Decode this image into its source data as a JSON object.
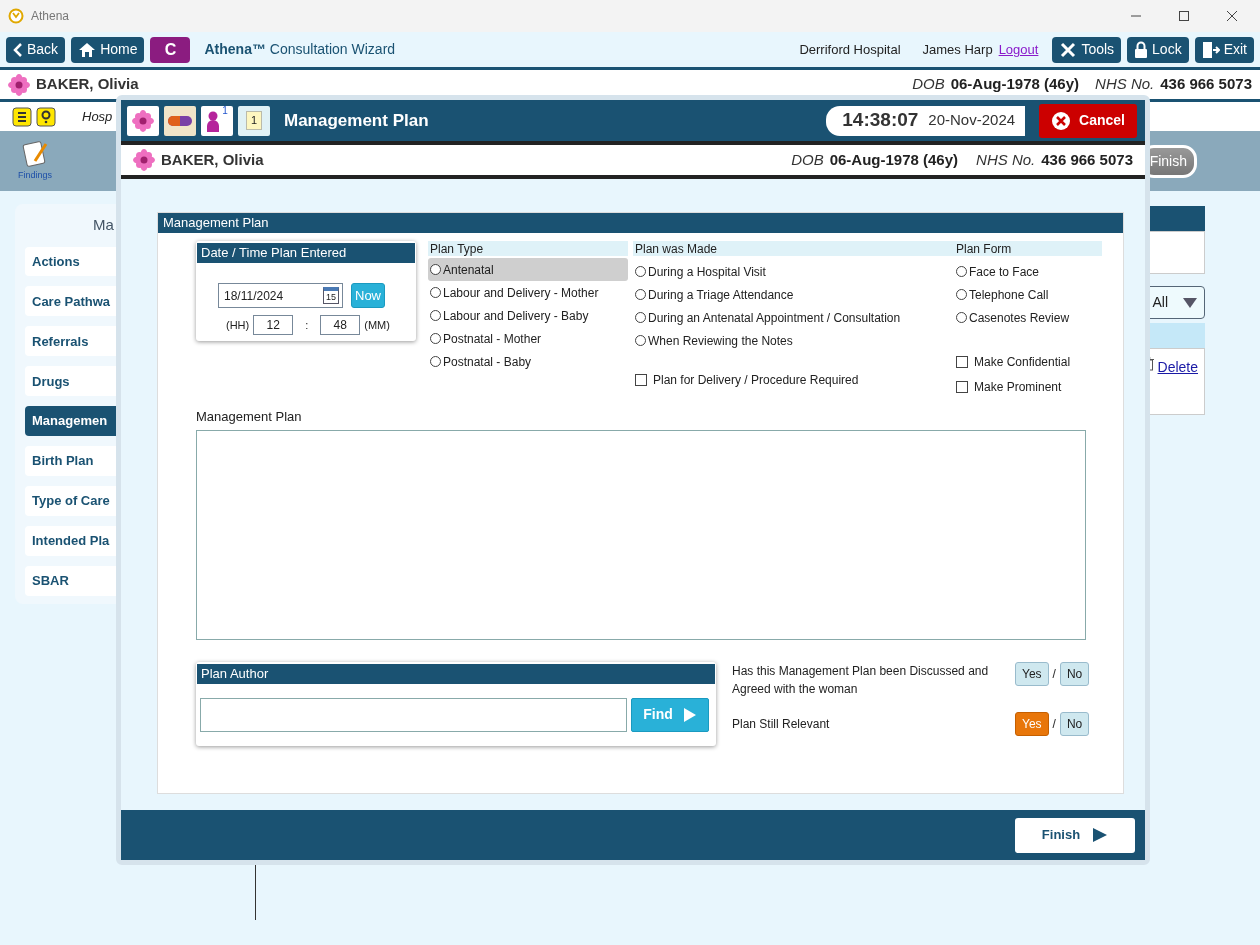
{
  "window": {
    "title": "Athena"
  },
  "toolbar": {
    "nav_buttons": [
      {
        "kind": "back",
        "label": "Back"
      },
      {
        "kind": "home",
        "label": "Home"
      }
    ],
    "badge": "C",
    "app_name": "Athena™",
    "app_subtitle": "Consultation Wizard",
    "hospital": "Derriford Hospital",
    "user": "James Harp",
    "logout": "Logout",
    "tool_buttons": [
      {
        "kind": "tools",
        "label": "Tools"
      },
      {
        "kind": "lock",
        "label": "Lock"
      },
      {
        "kind": "exit",
        "label": "Exit"
      }
    ]
  },
  "patient": {
    "name": "BAKER, Olivia",
    "dob_label": "DOB",
    "dob": "06-Aug-1978 (46y)",
    "nhs_label": "NHS No.",
    "nhs": "436 966 5073"
  },
  "info_bar": {
    "text": "Hosp"
  },
  "wizard_bar": {
    "findings": "Findings",
    "finish": {
      "label": "Finish",
      "disabled": true
    }
  },
  "sidebar": {
    "heading": "Ma",
    "items": [
      {
        "label": "Actions",
        "selected": false
      },
      {
        "label": "Care Pathwa",
        "selected": false
      },
      {
        "label": "Referrals",
        "selected": false
      },
      {
        "label": "Drugs",
        "selected": false
      },
      {
        "label": "Managemen",
        "selected": true
      },
      {
        "label": "Birth Plan",
        "selected": false
      },
      {
        "label": "Type of Care",
        "selected": false
      },
      {
        "label": "Intended Pla",
        "selected": false
      },
      {
        "label": "SBAR",
        "selected": false
      }
    ]
  },
  "right_panel": {
    "filter": "All",
    "link": "Delete"
  },
  "modal": {
    "icon_buttons": [
      {
        "kind": "flower"
      },
      {
        "kind": "pill"
      },
      {
        "kind": "person",
        "text": "1"
      },
      {
        "kind": "calendar",
        "text": "1"
      }
    ],
    "title": "Management Plan",
    "time": "14:38:07",
    "date": "20-Nov-2024",
    "cancel": "Cancel",
    "patient": {
      "name": "BAKER, Olivia",
      "dob_label": "DOB",
      "dob": "06-Aug-1978 (46y)",
      "nhs_label": "NHS No.",
      "nhs": "436 966 5073"
    },
    "section_title": "Management Plan",
    "date_time": {
      "title": "Date / Time Plan Entered",
      "date": "18/11/2024",
      "calendar_day": "15",
      "now": "Now",
      "hh_label": "(HH)",
      "hh": "12",
      "separator": ":",
      "mm": "48",
      "mm_label": "(MM)"
    },
    "plan_type": {
      "heading": "Plan Type",
      "options": [
        {
          "label": "Antenatal",
          "selected": false,
          "focused": true
        },
        {
          "label": "Labour and Delivery - Mother",
          "selected": false,
          "focused": false
        },
        {
          "label": "Labour and Delivery - Baby",
          "selected": false,
          "focused": false
        },
        {
          "label": "Postnatal - Mother",
          "selected": false,
          "focused": false
        },
        {
          "label": "Postnatal - Baby",
          "selected": false,
          "focused": false
        }
      ]
    },
    "plan_made": {
      "heading": "Plan was Made",
      "options": [
        {
          "label": "During a Hospital Visit",
          "selected": false
        },
        {
          "label": "During a Triage Attendance",
          "selected": false
        },
        {
          "label": "During an Antenatal Appointment / Consultation",
          "selected": false
        },
        {
          "label": "When Reviewing the Notes",
          "selected": false
        }
      ],
      "checkbox": {
        "label": "Plan for Delivery / Procedure Required",
        "checked": false
      }
    },
    "plan_form": {
      "heading": "Plan Form",
      "options": [
        {
          "label": "Face to Face",
          "selected": false
        },
        {
          "label": "Telephone Call",
          "selected": false
        },
        {
          "label": "Casenotes Review",
          "selected": false
        }
      ],
      "checkboxes": [
        {
          "label": "Make Confidential",
          "checked": false
        },
        {
          "label": "Make Prominent",
          "checked": false
        }
      ]
    },
    "notes": {
      "label": "Management Plan"
    },
    "author": {
      "title": "Plan Author",
      "find": "Find"
    },
    "questions": [
      {
        "text": "Has this Management Plan been Discussed and Agreed with the woman",
        "yes": "Yes",
        "separator": "/",
        "no": "No",
        "yes_selected": false,
        "no_selected": false
      },
      {
        "text": "Plan Still Relevant",
        "yes": "Yes",
        "separator": "/",
        "no": "No",
        "yes_selected": true,
        "no_selected": false
      }
    ],
    "finish": "Finish"
  }
}
